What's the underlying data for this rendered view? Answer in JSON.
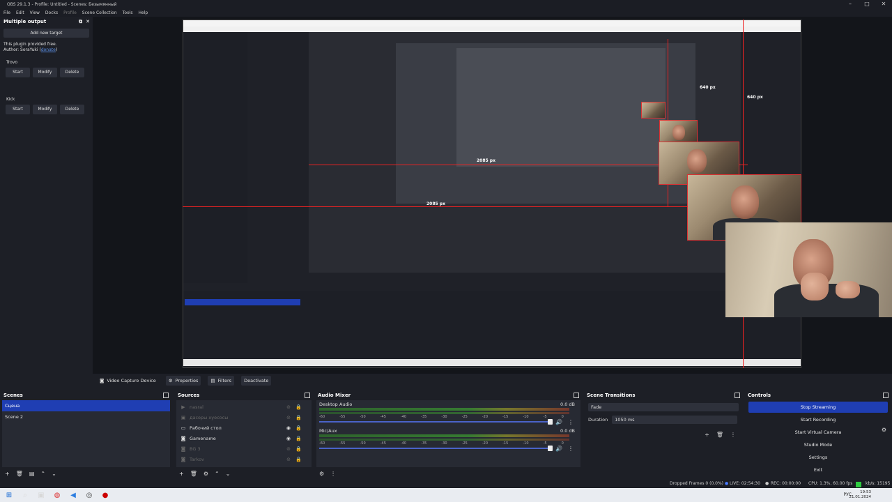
{
  "window": {
    "title": "OBS 29.1.3 - Profile: Untitled - Scenes: Безымянный"
  },
  "menu": [
    "File",
    "Edit",
    "View",
    "Docks",
    "Profile",
    "Scene Collection",
    "Tools",
    "Help"
  ],
  "multiple_output": {
    "title": "Multiple output",
    "add_target": "Add new target",
    "info_line1": "This plugin provided free.",
    "info_author": "Author: SoraYuki (",
    "info_donate": "donate",
    "info_close": ")",
    "targets": [
      {
        "name": "Trovo",
        "start": "Start",
        "modify": "Modify",
        "delete": "Delete"
      },
      {
        "name": "Kick",
        "start": "Start",
        "modify": "Modify",
        "delete": "Delete"
      }
    ]
  },
  "preview_labels": {
    "px_640_a": "640 px",
    "px_640_b": "640 px",
    "px_2085_a": "2085 px",
    "px_2085_b": "2085 px"
  },
  "source_toolbar": {
    "source_name": "Video Capture Device",
    "properties": "Properties",
    "filters": "Filters",
    "deactivate": "Deactivate"
  },
  "scenes": {
    "title": "Scenes",
    "items": [
      "Сцена",
      "Scene 2"
    ],
    "selected_index": 0
  },
  "sources": {
    "title": "Sources",
    "items": [
      {
        "name": "nasral",
        "icon": "play-icon",
        "visible": false
      },
      {
        "name": "дасеры хуесосы",
        "icon": "image-icon",
        "visible": false
      },
      {
        "name": "Рабочий стол",
        "icon": "monitor-icon",
        "visible": true
      },
      {
        "name": "Gamename",
        "icon": "camera-icon",
        "visible": true
      },
      {
        "name": "BG 3",
        "icon": "camera-icon",
        "visible": false
      },
      {
        "name": "Tarkov",
        "icon": "camera-icon",
        "visible": false
      }
    ]
  },
  "audio_mixer": {
    "title": "Audio Mixer",
    "channels": [
      {
        "name": "Desktop Audio",
        "db": "0.0 dB"
      },
      {
        "name": "Mic/Aux",
        "db": "0.0 dB"
      }
    ],
    "ticks": [
      "-60",
      "-55",
      "-50",
      "-45",
      "-40",
      "-35",
      "-30",
      "-25",
      "-20",
      "-15",
      "-10",
      "-5",
      "0"
    ]
  },
  "scene_transitions": {
    "title": "Scene Transitions",
    "transition": "Fade",
    "duration_label": "Duration",
    "duration_value": "1050 ms"
  },
  "controls": {
    "title": "Controls",
    "buttons": [
      "Stop Streaming",
      "Start Recording",
      "Start Virtual Camera",
      "Studio Mode",
      "Settings",
      "Exit"
    ]
  },
  "status": {
    "dropped": "Dropped Frames 0 (0.0%)",
    "live": "LIVE: 02:54:30",
    "rec": "REC: 00:00:00",
    "cpu": "CPU: 1.3%, 60.00 fps",
    "kbps": "kb/s: 15195"
  },
  "taskbar": {
    "lang": "РУС",
    "time": "19:53",
    "date": "21.01.2024"
  },
  "colors": {
    "accent": "#1f3eb3",
    "panel": "#272a33",
    "bg": "#1d1f26",
    "live_square": "#2ecc40",
    "guide": "#e22222"
  }
}
